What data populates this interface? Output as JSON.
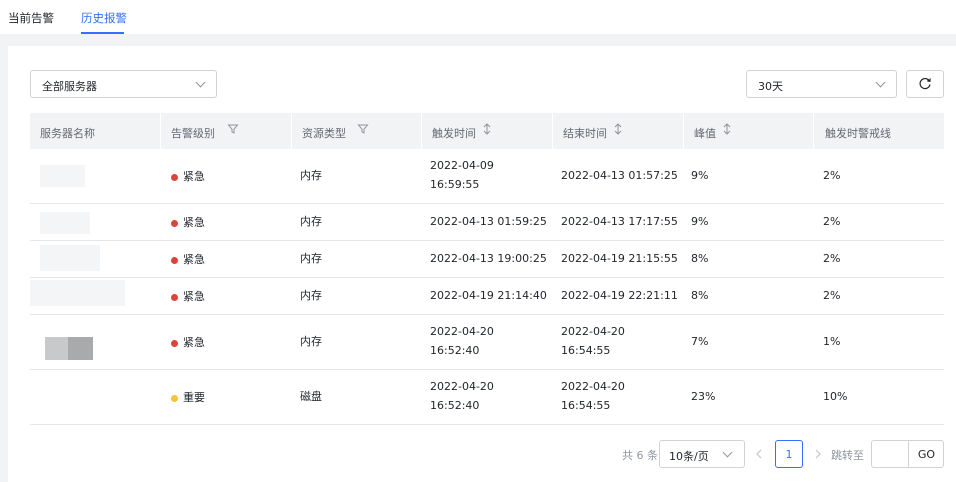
{
  "tabs": [
    {
      "label": "当前告警",
      "active": false
    },
    {
      "label": "历史报警",
      "active": true
    }
  ],
  "filters": {
    "server_select": "全部服务器",
    "range_select": "30天"
  },
  "table": {
    "columns": [
      "服务器名称",
      "告警级别",
      "资源类型",
      "触发时间",
      "结束时间",
      "峰值",
      "触发时警戒线"
    ],
    "rows": [
      {
        "server": "",
        "level": "紧急",
        "level_color": "#d9453d",
        "resource": "内存",
        "trigger_time": [
          "2022-04-09",
          "16:59:55"
        ],
        "end_time": [
          "2022-04-13 01:57:25"
        ],
        "peak": "9%",
        "threshold": "2%"
      },
      {
        "server": "",
        "level": "紧急",
        "level_color": "#d9453d",
        "resource": "内存",
        "trigger_time": [
          "2022-04-13 01:59:25"
        ],
        "end_time": [
          "2022-04-13 17:17:55"
        ],
        "peak": "9%",
        "threshold": "2%"
      },
      {
        "server": "",
        "level": "紧急",
        "level_color": "#d9453d",
        "resource": "内存",
        "trigger_time": [
          "2022-04-13 19:00:25"
        ],
        "end_time": [
          "2022-04-19 21:15:55"
        ],
        "peak": "8%",
        "threshold": "2%"
      },
      {
        "server": "",
        "level": "紧急",
        "level_color": "#d9453d",
        "resource": "内存",
        "trigger_time": [
          "2022-04-19 21:14:40"
        ],
        "end_time": [
          "2022-04-19 22:21:11"
        ],
        "peak": "8%",
        "threshold": "2%"
      },
      {
        "server": "",
        "level": "紧急",
        "level_color": "#d9453d",
        "resource": "内存",
        "trigger_time": [
          "2022-04-20",
          "16:52:40"
        ],
        "end_time": [
          "2022-04-20",
          "16:54:55"
        ],
        "peak": "7%",
        "threshold": "1%"
      },
      {
        "server": "",
        "level": "重要",
        "level_color": "#f5c431",
        "resource": "磁盘",
        "trigger_time": [
          "2022-04-20",
          "16:52:40"
        ],
        "end_time": [
          "2022-04-20",
          "16:54:55"
        ],
        "peak": "23%",
        "threshold": "10%"
      }
    ]
  },
  "pagination": {
    "total_text": "共 6 条",
    "page_size": "10条/页",
    "current_page": "1",
    "jump_label": "跳转至",
    "go_label": "GO",
    "jump_value": ""
  }
}
